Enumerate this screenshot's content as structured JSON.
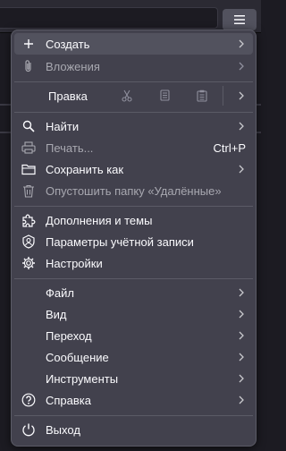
{
  "menu": {
    "new": "Создать",
    "attachments": "Вложения",
    "edit": "Правка",
    "find": "Найти",
    "print": "Печать...",
    "print_shortcut": "Ctrl+P",
    "save_as": "Сохранить как",
    "empty_deleted": "Опустошить папку «Удалённые»",
    "addons": "Дополнения и темы",
    "account_settings": "Параметры учётной записи",
    "settings": "Настройки",
    "file": "Файл",
    "view": "Вид",
    "go": "Переход",
    "message": "Сообщение",
    "tools": "Инструменты",
    "help": "Справка",
    "quit": "Выход"
  },
  "colors": {
    "menu_bg": "#42414d",
    "highlight": "#52525e",
    "text": "#fbfbfe",
    "disabled_text": "#a8a8b0"
  }
}
